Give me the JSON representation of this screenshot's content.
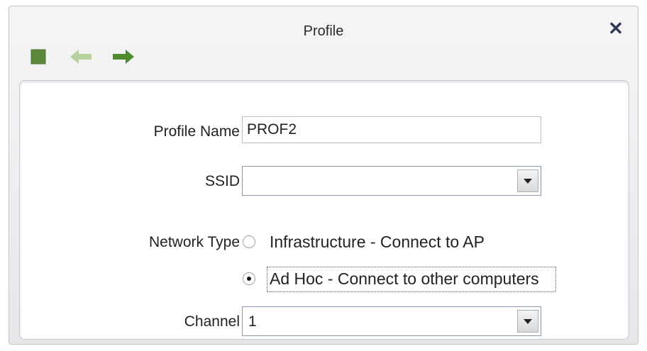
{
  "window": {
    "title": "Profile",
    "close_icon": "✕"
  },
  "toolbar": {
    "icons": [
      "stop-icon",
      "back-arrow-icon",
      "forward-arrow-icon"
    ],
    "colors": {
      "stop": "#5d8a3a",
      "back_disabled": "#b9d0a0",
      "forward": "#4f8a2c"
    }
  },
  "form": {
    "profile_name_label": "Profile Name",
    "profile_name_value": "PROF2",
    "ssid_label": "SSID",
    "ssid_value": "",
    "network_type_label": "Network Type",
    "network_type_options": [
      {
        "label": "Infrastructure - Connect to AP",
        "selected": false
      },
      {
        "label": "Ad Hoc - Connect to other computers",
        "selected": true
      }
    ],
    "channel_label": "Channel",
    "channel_value": "1"
  }
}
